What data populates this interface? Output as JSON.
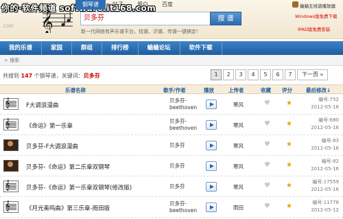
{
  "watermark": "你的·软件频道 software.it168.com",
  "logo_text": ".COM",
  "top_nav": [
    "钢琴谱",
    "帖子",
    "用户",
    "百度"
  ],
  "search": {
    "value": "贝多芬",
    "button": "搜 谱"
  },
  "tagline": "新一代网络有声乐谱平台，找谱、识谱、传谱一键搞定!",
  "product": {
    "name": "蛐蛐五线谱播放器",
    "promo1": "Windows版免费下载",
    "promo2": "IPAD版免费安装"
  },
  "main_nav": [
    "我的乐谱",
    "家园",
    "群组",
    "排行榜",
    "蛐蛐论坛",
    "软件下载"
  ],
  "breadcrumb": "> 搜索",
  "result": {
    "prefix": "共搜到",
    "count": "147",
    "middle": "个钢琴谱，关键词：",
    "keyword": "贝多芬"
  },
  "pager": [
    "1",
    "2",
    "3",
    "4",
    "5",
    "6",
    "7",
    "下一页 »"
  ],
  "columns": {
    "title": "乐谱名称",
    "singer": "歌手/作者",
    "play": "播放",
    "uploader": "上传者",
    "fav": "收藏",
    "rating": "评分",
    "latest": "最后修改↓"
  },
  "rows": [
    {
      "icon": "sheet",
      "title": "F大调浪漫曲",
      "singer1": "贝多芬-",
      "singer2": "beethoven",
      "uploader": "寒风",
      "num": "编号:752",
      "date": "2012-05-16"
    },
    {
      "icon": "sheet",
      "title": "《命运》第一乐章",
      "singer1": "贝多芬-",
      "singer2": "beethoven",
      "uploader": "寒风",
      "num": "编号:680",
      "date": "2012-05-16"
    },
    {
      "icon": "photo",
      "title": "贝多芬-F大调浪漫曲",
      "singer1": "贝多芬",
      "singer2": "",
      "uploader": "寒风",
      "num": "编号:83",
      "date": "2012-05-16"
    },
    {
      "icon": "photo",
      "title": "贝多芬-《命运》第二乐章双钢琴",
      "singer1": "贝多芬",
      "singer2": "",
      "uploader": "寒风",
      "num": "编号:82",
      "date": "2012-05-16"
    },
    {
      "icon": "sheet",
      "title": "贝多芬-《命运》第一乐章双钢琴(修改版)",
      "singer1": "贝多芬",
      "singer2": "",
      "uploader": "寒风",
      "num": "编号:17559",
      "date": "2012-05-16"
    },
    {
      "icon": "sheet",
      "title": "《月光奏鸣曲》第三乐章-雨田版",
      "singer1": "贝多芬-",
      "singer2": "beethoven",
      "uploader": "雨田",
      "num": "编号:11776",
      "date": "2012-05-12"
    }
  ]
}
